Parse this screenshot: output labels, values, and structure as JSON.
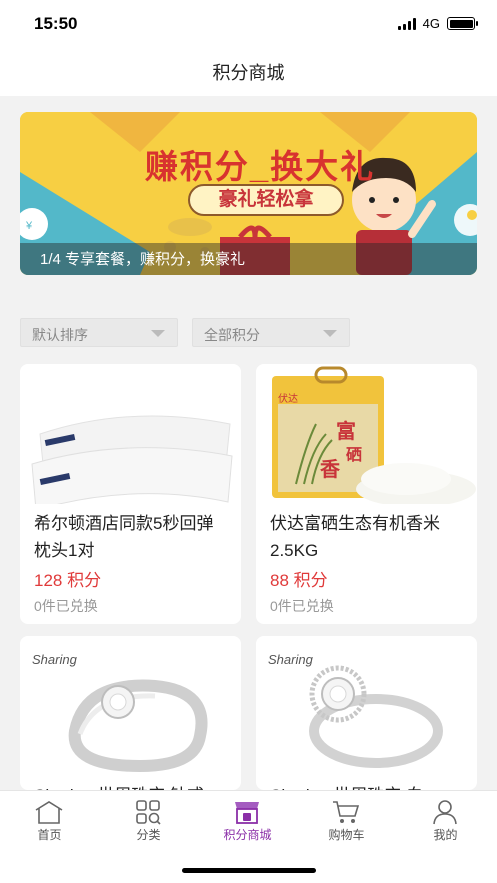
{
  "status": {
    "time": "15:50",
    "network": "4G"
  },
  "nav": {
    "title": "积分商城"
  },
  "banner": {
    "headline": "赚积分_换大礼",
    "subline": "豪礼轻松拿",
    "caption": "1/4 专享套餐，赚积分，换豪礼"
  },
  "filters": [
    {
      "label": "默认排序"
    },
    {
      "label": "全部积分"
    }
  ],
  "products": [
    {
      "name": "希尔顿酒店同款5秒回弹枕头1对",
      "points": "128 积分",
      "sold": "0件已兑换",
      "image_icon": "pillow-image"
    },
    {
      "name": "伏达富硒生态有机香米2.5KG",
      "points": "88 积分",
      "sold": "0件已兑换",
      "image_icon": "rice-bag-image",
      "package_text": "伏达",
      "package_big": "富硒香"
    },
    {
      "name": "Sharing 世周珠宝 钻戒",
      "points": "",
      "sold": "",
      "image_icon": "ring-image",
      "brand": "Sharing"
    },
    {
      "name": "Sharing 世周珠宝 白",
      "points": "",
      "sold": "",
      "image_icon": "ring-image",
      "brand": "Sharing"
    }
  ],
  "tabs": [
    {
      "label": "首页",
      "icon": "home-icon"
    },
    {
      "label": "分类",
      "icon": "category-icon"
    },
    {
      "label": "积分商城",
      "icon": "points-mall-icon",
      "active": true
    },
    {
      "label": "购物车",
      "icon": "cart-icon"
    },
    {
      "label": "我的",
      "icon": "user-icon"
    }
  ],
  "colors": {
    "accent": "#8b2fa8",
    "price": "#e03a3a",
    "banner_yellow": "#f7cf43",
    "banner_teal": "#53b8c9"
  }
}
